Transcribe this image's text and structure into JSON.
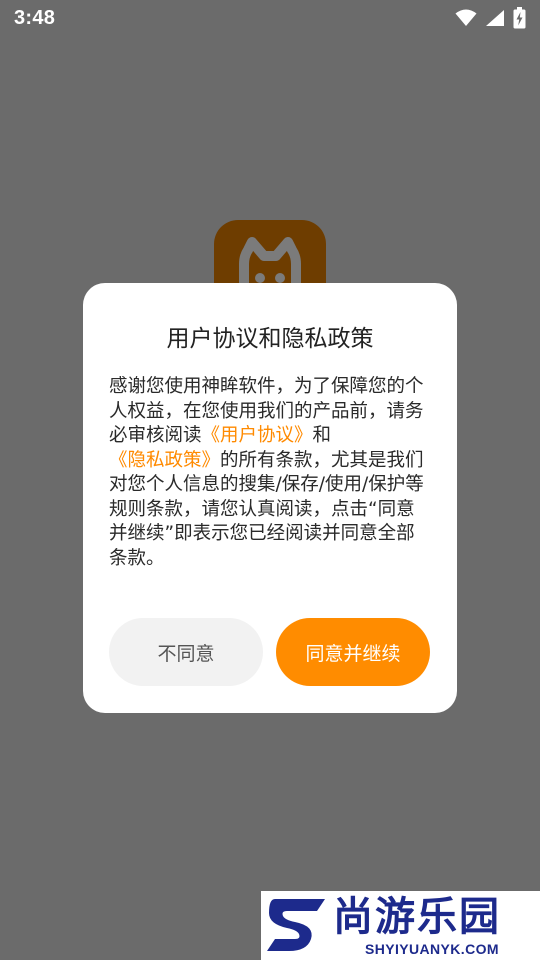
{
  "status_bar": {
    "time": "3:48",
    "icons": [
      "wifi-icon",
      "signal-icon",
      "battery-charging-icon"
    ]
  },
  "app_logo": {
    "icon": "cat-face-icon",
    "color": "#6e3d00"
  },
  "dialog": {
    "title": "用户协议和隐私政策",
    "body": {
      "part1": "感谢您使用神眸软件，为了保障您的个人权益，在您使用我们的产品前，请务必审核阅读",
      "link_user_agreement": "《用户协议》",
      "part2": "和",
      "link_privacy_policy": "《隐私政策》",
      "part3": "的所有条款，尤其是我们对您个人信息的搜集/保存/使用/保护等规则条款，请您认真阅读，点击“同意并继续”即表示您已经阅读并同意全部条款。"
    },
    "disagree_label": "不同意",
    "agree_label": "同意并继续"
  },
  "watermark": {
    "title": "尚游乐园",
    "subtitle": "SHYIYUANYK.COM"
  },
  "colors": {
    "accent": "#ff8c00",
    "overlay": "#6b6b6b",
    "watermark_blue": "#1d2a8c"
  }
}
